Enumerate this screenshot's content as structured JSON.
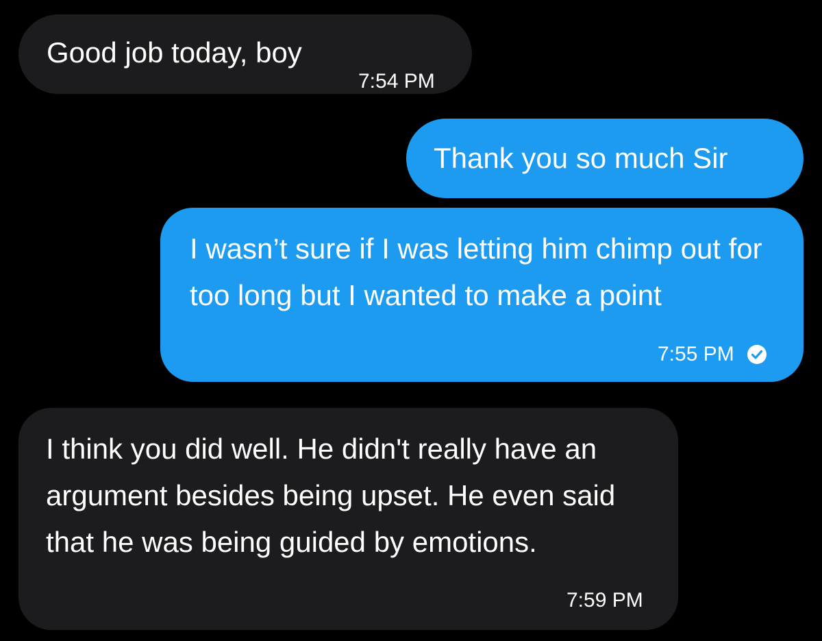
{
  "colors": {
    "background": "#000000",
    "incoming_bubble": "#1c1c1f",
    "outgoing_bubble": "#1d9bf0",
    "text": "#ffffff"
  },
  "messages": [
    {
      "direction": "incoming",
      "text": "Good job today, boy",
      "time": "7:54 PM"
    },
    {
      "direction": "outgoing",
      "text": "Thank you so much Sir",
      "time": ""
    },
    {
      "direction": "outgoing",
      "text": "I wasn’t sure if I was letting him chimp out for too long but I wanted to make a point",
      "time": "7:55 PM",
      "status_icon": "check-circle-icon"
    },
    {
      "direction": "incoming",
      "text": "I think you did well. He didn't really have an argument besides being upset. He even said that he was being guided by emotions.",
      "time": "7:59 PM"
    }
  ]
}
